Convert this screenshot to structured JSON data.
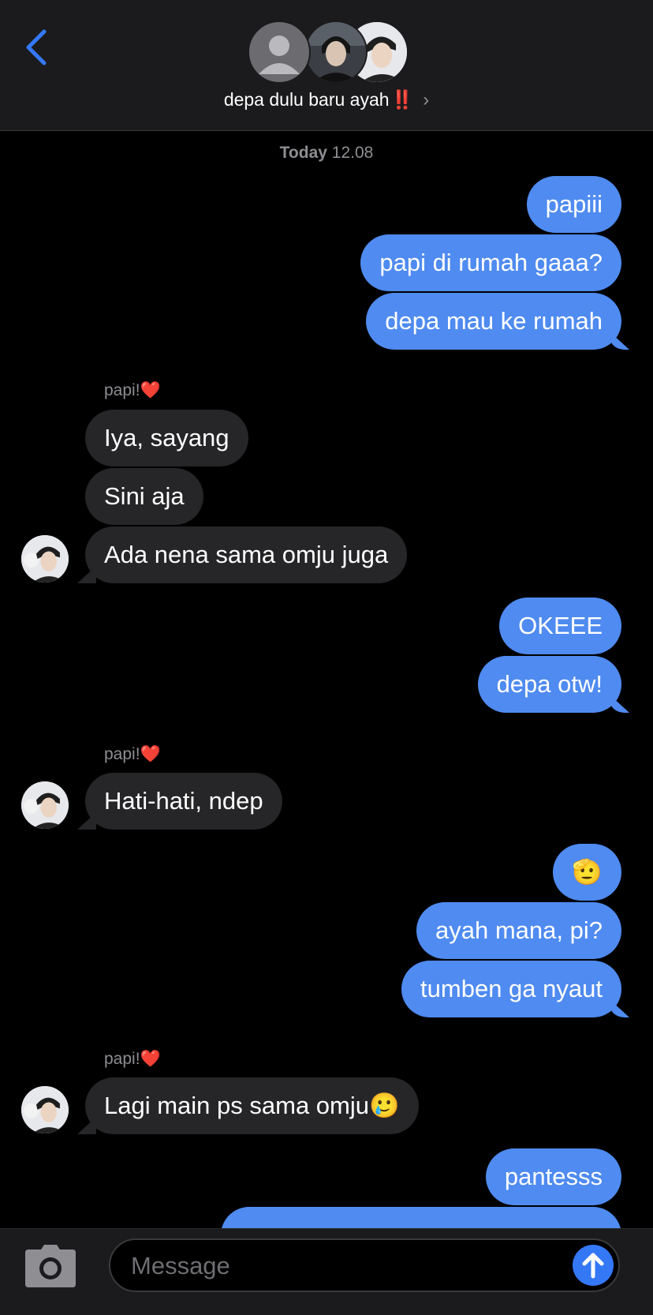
{
  "header": {
    "group_name": "depa dulu baru ayah",
    "group_name_emoji": "‼️",
    "chevron": "›",
    "back_icon": "chevron-left-icon",
    "accent_color": "#3478f6"
  },
  "conversation": {
    "timestamp_day": "Today",
    "timestamp_time": "12.08",
    "sender_name": "papi!",
    "sender_emoji": "❤️",
    "messages": [
      {
        "from": "me",
        "text": "papiii"
      },
      {
        "from": "me",
        "text": "papi di rumah gaaa?"
      },
      {
        "from": "me",
        "text": "depa mau ke rumah"
      },
      {
        "from": "papi",
        "text": "Iya, sayang"
      },
      {
        "from": "papi",
        "text": "Sini aja"
      },
      {
        "from": "papi",
        "text": "Ada nena sama omju juga"
      },
      {
        "from": "me",
        "text": "OKEEE"
      },
      {
        "from": "me",
        "text": "depa otw!"
      },
      {
        "from": "papi",
        "text": "Hati-hati, ndep"
      },
      {
        "from": "me",
        "text": "🫡"
      },
      {
        "from": "me",
        "text": "ayah mana, pi?"
      },
      {
        "from": "me",
        "text": "tumben ga nyaut"
      },
      {
        "from": "papi",
        "text": "Lagi main ps sama omju🥲"
      },
      {
        "from": "me",
        "text": "pantesss"
      }
    ],
    "sent_color": "#4f8bf0",
    "received_color": "#262628"
  },
  "composer": {
    "placeholder": "Message",
    "camera_icon": "camera-icon",
    "send_icon": "arrow-up-icon"
  }
}
